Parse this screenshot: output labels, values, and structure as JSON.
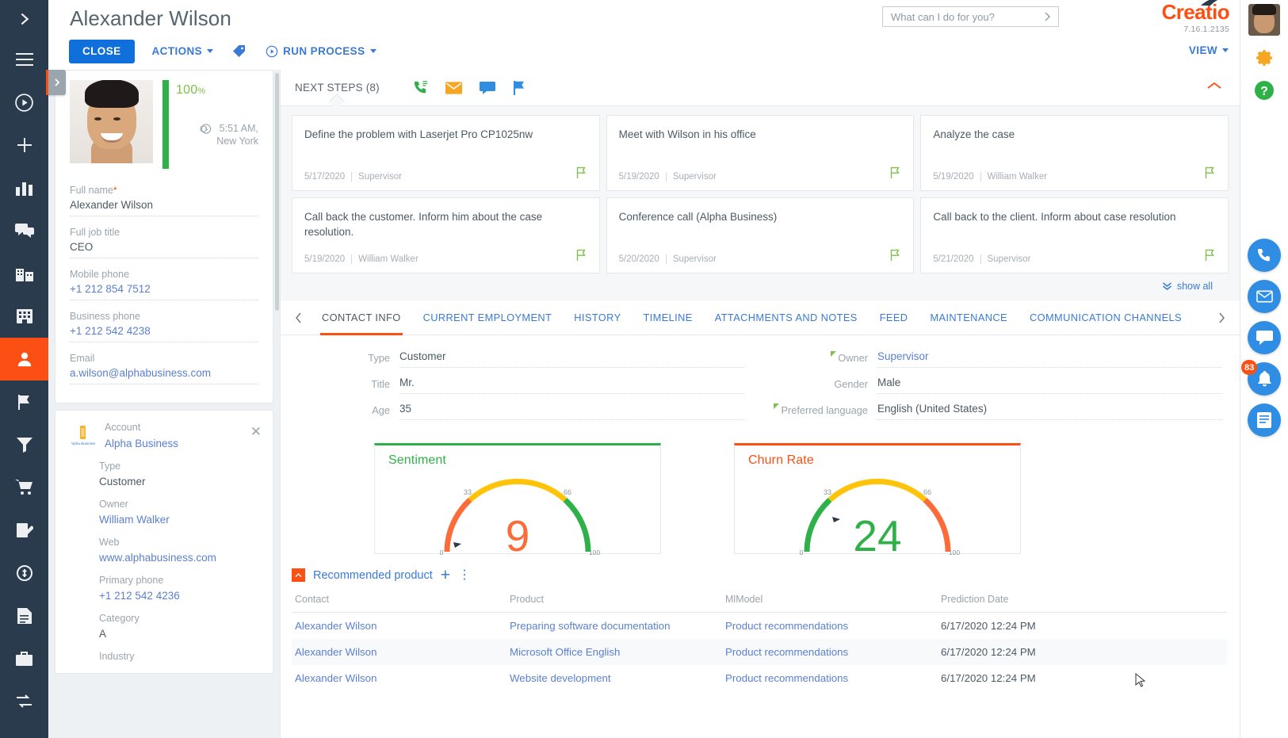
{
  "header": {
    "page_title": "Alexander Wilson",
    "close_label": "CLOSE",
    "actions_label": "ACTIONS",
    "run_process_label": "RUN PROCESS",
    "tag_icon": "tag-icon",
    "view_label": "VIEW",
    "search_placeholder": "What can I do for you?",
    "search_value": "",
    "logo_text": "Creatio",
    "version": "7.16.1.2135"
  },
  "left_nav": {
    "items": [
      {
        "name": "expand-menu",
        "icon": "chevron-right-icon"
      },
      {
        "name": "main-menu",
        "icon": "hamburger-icon"
      },
      {
        "name": "run",
        "icon": "play-circle-icon"
      },
      {
        "name": "add",
        "icon": "plus-icon"
      },
      {
        "name": "dashboards",
        "icon": "bar-chart-icon"
      },
      {
        "name": "feed",
        "icon": "comments-icon"
      },
      {
        "name": "accounts",
        "icon": "building-icon"
      },
      {
        "name": "employees",
        "icon": "office-icon"
      },
      {
        "name": "contacts",
        "icon": "person-icon",
        "active": true
      },
      {
        "name": "activities",
        "icon": "flag-icon"
      },
      {
        "name": "leads",
        "icon": "funnel-icon"
      },
      {
        "name": "orders",
        "icon": "cart-icon"
      },
      {
        "name": "contracts",
        "icon": "edit-doc-icon"
      },
      {
        "name": "invoices",
        "icon": "coin-icon"
      },
      {
        "name": "documents",
        "icon": "document-icon"
      },
      {
        "name": "products",
        "icon": "briefcase-icon"
      },
      {
        "name": "processes",
        "icon": "process-icon"
      }
    ]
  },
  "right_rail": {
    "avatar": "user-avatar",
    "gear": "gear-icon",
    "help": "help-icon",
    "buttons": [
      {
        "name": "call-button",
        "icon": "phone-icon"
      },
      {
        "name": "email-button",
        "icon": "envelope-icon"
      },
      {
        "name": "chat-button",
        "icon": "chat-icon"
      },
      {
        "name": "notifications-button",
        "icon": "bell-icon",
        "badge": "83"
      },
      {
        "name": "notes-button",
        "icon": "notes-icon"
      }
    ]
  },
  "profile": {
    "completeness_percent": "100",
    "completeness_unit": "%",
    "local_time": "5:51 AM,",
    "local_city": "New York",
    "fields": [
      {
        "label": "Full name",
        "required": true,
        "value": "Alexander Wilson",
        "link": false
      },
      {
        "label": "Full job title",
        "required": false,
        "value": "CEO",
        "link": false
      },
      {
        "label": "Mobile phone",
        "required": false,
        "value": "+1 212 854 7512",
        "link": true
      },
      {
        "label": "Business phone",
        "required": false,
        "value": "+1 212 542 4238",
        "link": true
      },
      {
        "label": "Email",
        "required": false,
        "value": "a.wilson@alphabusiness.com",
        "link": true
      }
    ],
    "account": {
      "label": "Account",
      "name": "Alpha Business",
      "fields": [
        {
          "label": "Type",
          "value": "Customer",
          "link": false
        },
        {
          "label": "Owner",
          "value": "William Walker",
          "link": true
        },
        {
          "label": "Web",
          "value": "www.alphabusiness.com",
          "link": true
        },
        {
          "label": "Primary phone",
          "value": "+1 212 542 4236",
          "link": true
        },
        {
          "label": "Category",
          "value": "A",
          "link": false
        },
        {
          "label": "Industry",
          "value": "",
          "link": false
        }
      ]
    }
  },
  "next_steps": {
    "title": "NEXT STEPS (8)",
    "quick_icons": [
      {
        "name": "call-icon"
      },
      {
        "name": "email-icon"
      },
      {
        "name": "message-icon"
      },
      {
        "name": "flag-icon"
      }
    ],
    "show_all_label": "show all",
    "cards": [
      {
        "subject": "Define the problem with Laserjet Pro CP1025nw",
        "date": "5/17/2020",
        "owner": "Supervisor"
      },
      {
        "subject": "Meet with Wilson in his office",
        "date": "5/19/2020",
        "owner": "Supervisor"
      },
      {
        "subject": "Analyze the case",
        "date": "5/19/2020",
        "owner": "William Walker"
      },
      {
        "subject": "Call back the customer. Inform him about the case resolution.",
        "date": "5/19/2020",
        "owner": "William Walker"
      },
      {
        "subject": "Conference call (Alpha Business)",
        "date": "5/20/2020",
        "owner": "Supervisor"
      },
      {
        "subject": "Call back to the client. Inform about case resolution",
        "date": "5/21/2020",
        "owner": "Supervisor"
      }
    ]
  },
  "tabs": [
    {
      "label": "CONTACT INFO",
      "active": true
    },
    {
      "label": "CURRENT EMPLOYMENT",
      "active": false
    },
    {
      "label": "HISTORY",
      "active": false
    },
    {
      "label": "TIMELINE",
      "active": false
    },
    {
      "label": "ATTACHMENTS AND NOTES",
      "active": false
    },
    {
      "label": "FEED",
      "active": false
    },
    {
      "label": "MAINTENANCE",
      "active": false
    },
    {
      "label": "COMMUNICATION CHANNELS",
      "active": false
    }
  ],
  "contact_info": {
    "left": [
      {
        "label": "Type",
        "value": "Customer",
        "link": false,
        "mark": false
      },
      {
        "label": "Title",
        "value": "Mr.",
        "link": false,
        "mark": false
      },
      {
        "label": "Age",
        "value": "35",
        "link": false,
        "mark": false
      }
    ],
    "right": [
      {
        "label": "Owner",
        "value": "Supervisor",
        "link": true,
        "mark": true
      },
      {
        "label": "Gender",
        "value": "Male",
        "link": false,
        "mark": false
      },
      {
        "label": "Preferred language",
        "value": "English (United States)",
        "link": false,
        "mark": true
      }
    ]
  },
  "chart_data": [
    {
      "type": "gauge",
      "title": "Sentiment",
      "value": 9,
      "min": 0,
      "max": 100,
      "tick_labels": [
        "0",
        "33",
        "66",
        "100"
      ],
      "tick_values": [
        0,
        33,
        66,
        100
      ],
      "value_color": "#fb6c3a",
      "title_color": "#2fb14a",
      "accent_color": "#2fb14a",
      "bands": [
        {
          "from": 0,
          "to": 33,
          "color": "#fb6c3a"
        },
        {
          "from": 33,
          "to": 66,
          "color": "#ffc40a"
        },
        {
          "from": 66,
          "to": 100,
          "color": "#2fb14a"
        }
      ]
    },
    {
      "type": "gauge",
      "title": "Churn Rate",
      "value": 24,
      "min": 0,
      "max": 100,
      "tick_labels": [
        "0",
        "33",
        "66",
        "100"
      ],
      "tick_values": [
        0,
        33,
        66,
        100
      ],
      "value_color": "#2fb14a",
      "title_color": "#fb4f14",
      "accent_color": "#fb4f14",
      "bands": [
        {
          "from": 0,
          "to": 33,
          "color": "#2fb14a"
        },
        {
          "from": 33,
          "to": 66,
          "color": "#ffc40a"
        },
        {
          "from": 66,
          "to": 100,
          "color": "#fb6c3a"
        }
      ]
    }
  ],
  "recommended_product": {
    "title": "Recommended product",
    "add_label": "+",
    "menu_label": "⋮",
    "columns": [
      "Contact",
      "Product",
      "MlModel",
      "Prediction Date"
    ],
    "rows": [
      [
        "Alexander Wilson",
        "Preparing software documentation",
        "Product recommendations",
        "6/17/2020 12:24 PM"
      ],
      [
        "Alexander Wilson",
        "Microsoft Office English",
        "Product recommendations",
        "6/17/2020 12:24 PM"
      ],
      [
        "Alexander Wilson",
        "Website development",
        "Product recommendations",
        "6/17/2020 12:24 PM"
      ]
    ]
  }
}
